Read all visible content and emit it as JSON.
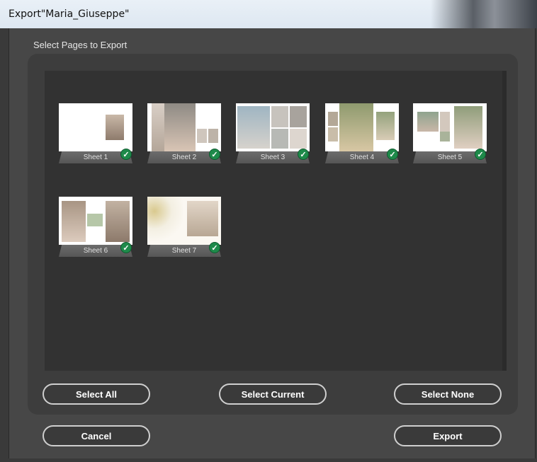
{
  "window": {
    "title": "Export\"Maria_Giuseppe\""
  },
  "dialog": {
    "section_label": "Select Pages to Export",
    "sheets": [
      {
        "label": "Sheet 1",
        "checked": true
      },
      {
        "label": "Sheet 2",
        "checked": true
      },
      {
        "label": "Sheet 3",
        "checked": true
      },
      {
        "label": "Sheet 4",
        "checked": true
      },
      {
        "label": "Sheet 5",
        "checked": true
      },
      {
        "label": "Sheet 6",
        "checked": true
      },
      {
        "label": "Sheet 7",
        "checked": true
      }
    ],
    "select_all_label": "Select All",
    "select_current_label": "Select Current",
    "select_none_label": "Select None",
    "cancel_label": "Cancel",
    "export_label": "Export"
  },
  "icons": {
    "check": "check-icon"
  },
  "colors": {
    "accent_check": "#1e8a4a",
    "dialog_bg": "#474747",
    "thumb_area": "#323232"
  }
}
